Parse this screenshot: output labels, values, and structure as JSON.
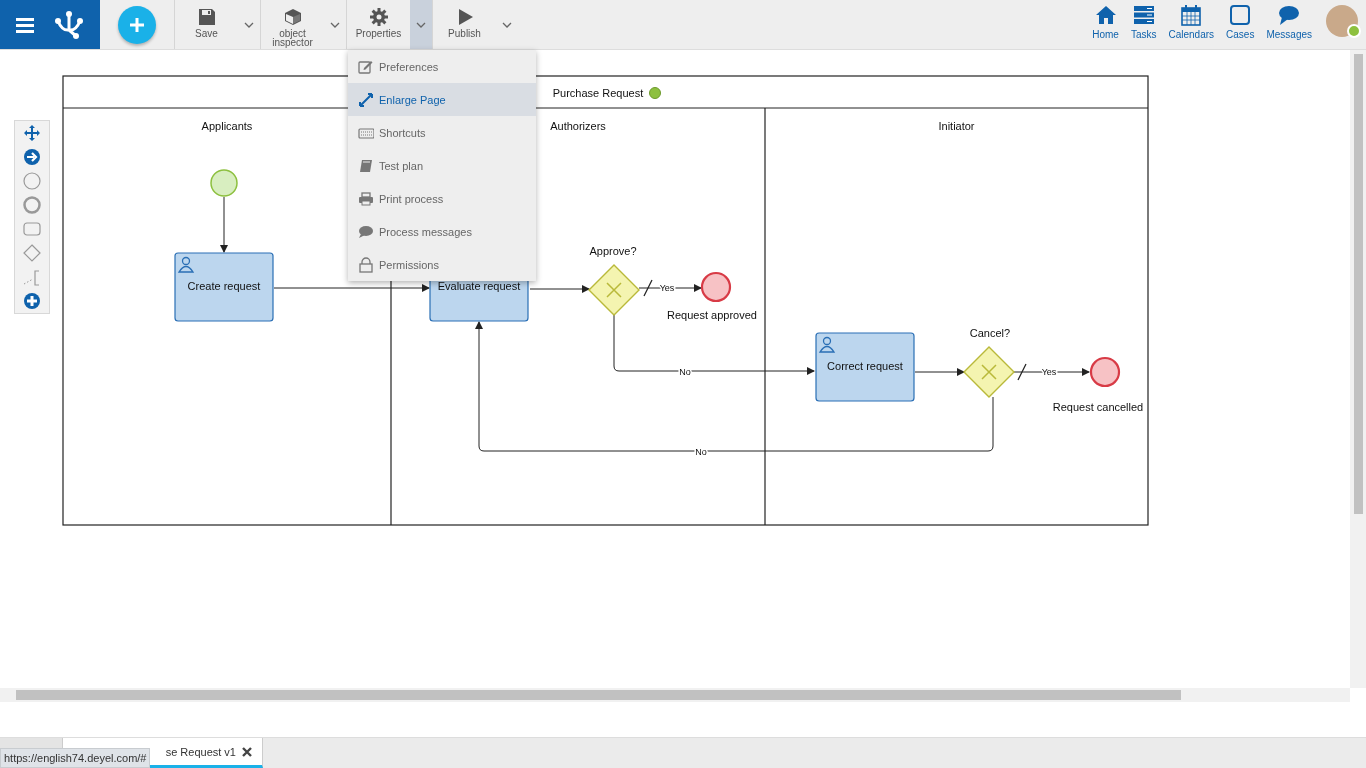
{
  "toolbar": {
    "tools": [
      {
        "label": "Save",
        "kind": "save",
        "expanded": false
      },
      {
        "label": "object inspector",
        "kind": "inspector",
        "expanded": false
      },
      {
        "label": "Properties",
        "kind": "properties",
        "expanded": true
      },
      {
        "label": "Publish",
        "kind": "publish",
        "expanded": false
      }
    ]
  },
  "nav": [
    {
      "label": "Home",
      "kind": "home"
    },
    {
      "label": "Tasks",
      "kind": "tasks"
    },
    {
      "label": "Calendars",
      "kind": "calendars"
    },
    {
      "label": "Cases",
      "kind": "cases"
    },
    {
      "label": "Messages",
      "kind": "messages"
    }
  ],
  "user": {
    "online": true
  },
  "properties_menu": {
    "items": [
      {
        "label": "Preferences",
        "kind": "preferences",
        "selected": false
      },
      {
        "label": "Enlarge Page",
        "kind": "enlarge",
        "selected": true
      },
      {
        "label": "Shortcuts",
        "kind": "shortcuts",
        "selected": false
      },
      {
        "label": "Test plan",
        "kind": "testplan",
        "selected": false
      },
      {
        "label": "Print process",
        "kind": "print",
        "selected": false
      },
      {
        "label": "Process messages",
        "kind": "messages",
        "selected": false
      },
      {
        "label": "Permissions",
        "kind": "permissions",
        "selected": false
      }
    ]
  },
  "palette": {
    "tools": [
      {
        "kind": "move"
      },
      {
        "kind": "connect"
      },
      {
        "kind": "start"
      },
      {
        "kind": "end"
      },
      {
        "kind": "task"
      },
      {
        "kind": "gateway"
      },
      {
        "kind": "annotation"
      },
      {
        "kind": "more"
      }
    ]
  },
  "diagram": {
    "pool": {
      "title": "Purchase Request",
      "valid": true
    },
    "lanes": [
      {
        "label": "Applicants"
      },
      {
        "label": "Authorizers"
      },
      {
        "label": "Initiator"
      }
    ],
    "nodes": [
      {
        "kind": "start"
      },
      {
        "kind": "task",
        "label": "Create request"
      },
      {
        "kind": "task",
        "label": "Evaluate request"
      },
      {
        "kind": "gateway",
        "label": "Approve?"
      },
      {
        "kind": "end",
        "label": "Request approved"
      },
      {
        "kind": "task",
        "label": "Correct request"
      },
      {
        "kind": "gateway",
        "label": "Cancel?"
      },
      {
        "kind": "end",
        "label": "Request cancelled"
      }
    ],
    "flows": [
      {
        "label": "Yes",
        "default": true
      },
      {
        "label": "No",
        "default": false
      },
      {
        "label": "Yes",
        "default": true
      },
      {
        "label": "No",
        "default": false
      }
    ]
  },
  "bottom_tabs": [
    {
      "selected": false
    },
    {
      "label": "se Request v1",
      "selected": true
    }
  ],
  "status_url": "https://english74.deyel.com/#"
}
